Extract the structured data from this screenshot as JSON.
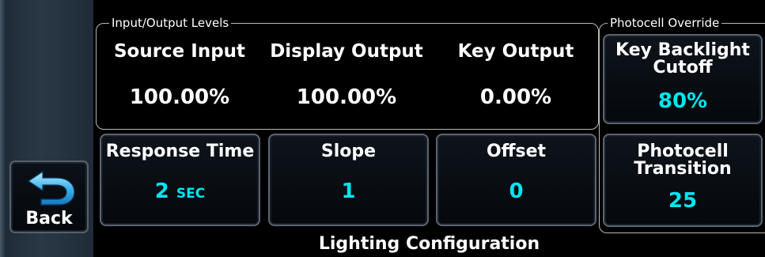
{
  "colors": {
    "accent_cyan": "#00e6f0",
    "border_gray": "#5b6570",
    "background": "#000000"
  },
  "sidebar": {
    "back_button": {
      "label": "Back",
      "icon": "back-arrow-icon"
    }
  },
  "io_levels": {
    "title": "Input/Output Levels",
    "columns": [
      {
        "label": "Source Input",
        "value": "100.00%"
      },
      {
        "label": "Display Output",
        "value": "100.00%"
      },
      {
        "label": "Key Output",
        "value": "0.00%"
      }
    ]
  },
  "photocell_override": {
    "title": "Photocell Override",
    "key_backlight": {
      "label_line1": "Key Backlight",
      "label_line2": "Cutoff",
      "value": "80%"
    },
    "transition": {
      "label_line1": "Photocell",
      "label_line2": "Transition",
      "value": "25"
    }
  },
  "controls": {
    "response_time": {
      "label": "Response Time",
      "value": "2",
      "unit": "SEC"
    },
    "slope": {
      "label": "Slope",
      "value": "1"
    },
    "offset": {
      "label": "Offset",
      "value": "0"
    }
  },
  "footer": {
    "title": "Lighting Configuration"
  }
}
